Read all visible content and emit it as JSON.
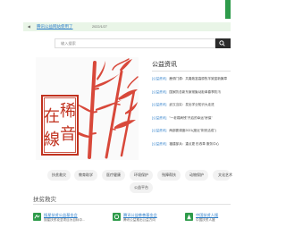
{
  "notice": {
    "link": "腾讯公益网站使用了",
    "date": "2022/1/27"
  },
  "search": {
    "placeholder": "输入搜索"
  },
  "banner": {
    "seal_chars": [
      "稀",
      "音",
      "在",
      "線"
    ]
  },
  "news": {
    "title": "公益资讯",
    "items": [
      {
        "tag": "[公益资讯]",
        "text": "鹿嶺门源：共奏致富高原牧羊致富新篇章"
      },
      {
        "tag": "[公益资讯]",
        "text": "国家防总新东案常聚动拒单春季防汛"
      },
      {
        "tag": "[公益资讯]",
        "text": "武汉当实：发出学业知识大走进"
      },
      {
        "tag": "[公益资讯]",
        "text": "\"一老弱病残\"开启的幸运\"房保\""
      },
      {
        "tag": "[公益资讯]",
        "text": "两部委调度2021(度近\"荆安活成\")"
      },
      {
        "tag": "[公益资讯]",
        "text": "福建部兵：重点更 形改革 服务中心"
      }
    ]
  },
  "categories": [
    "扶贫救灾",
    "教育助学",
    "医疗健康",
    "环境保护",
    "残障帮扶",
    "动物保护",
    "文化艺术",
    "公益平台"
  ],
  "section": {
    "title": "扶贫救灾"
  },
  "orgs": [
    {
      "name": "搜星扶贫公益基金会",
      "desc": "搜星扶贫攻坚项目为目标中..."
    },
    {
      "name": "腾讯公益慈善基金会",
      "desc": "腾讯公益推出公益方向"
    },
    {
      "name": "中国扶贫人援",
      "desc": "中国扶贫人援"
    }
  ],
  "colors": {
    "accent_green": "#2e9b4a",
    "link_blue": "#2d7ec9",
    "seal_red": "#c1321f",
    "bamboo": "#d8483a"
  }
}
